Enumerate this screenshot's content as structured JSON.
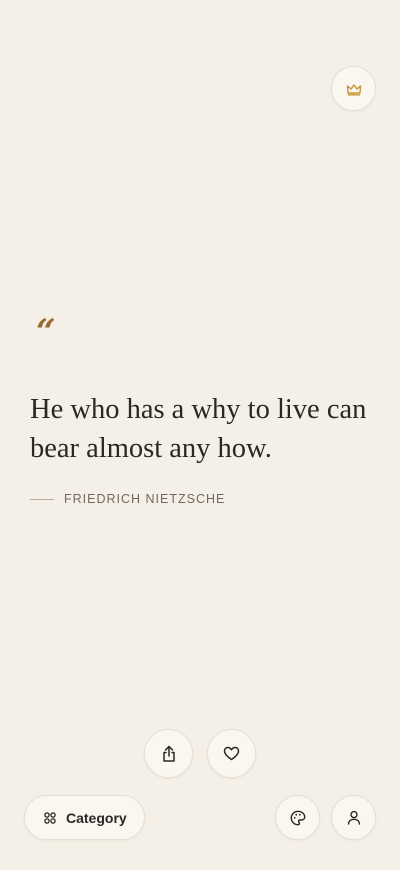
{
  "quote": {
    "mark": "“",
    "text": "He who has a why to live can bear almost any how.",
    "author": "FRIEDRICH NIETZSCHE"
  },
  "top_actions": {
    "premium_icon": "crown-icon"
  },
  "quote_actions": {
    "share_icon": "share-icon",
    "favorite_icon": "heart-icon"
  },
  "bottom_bar": {
    "category_label": "Category",
    "category_icon": "grid-icon",
    "theme_icon": "palette-icon",
    "profile_icon": "user-icon"
  },
  "colors": {
    "background": "#f5f0e7",
    "accent": "#9a6a2e",
    "text": "#2b2724",
    "crown": "#c8922f"
  }
}
